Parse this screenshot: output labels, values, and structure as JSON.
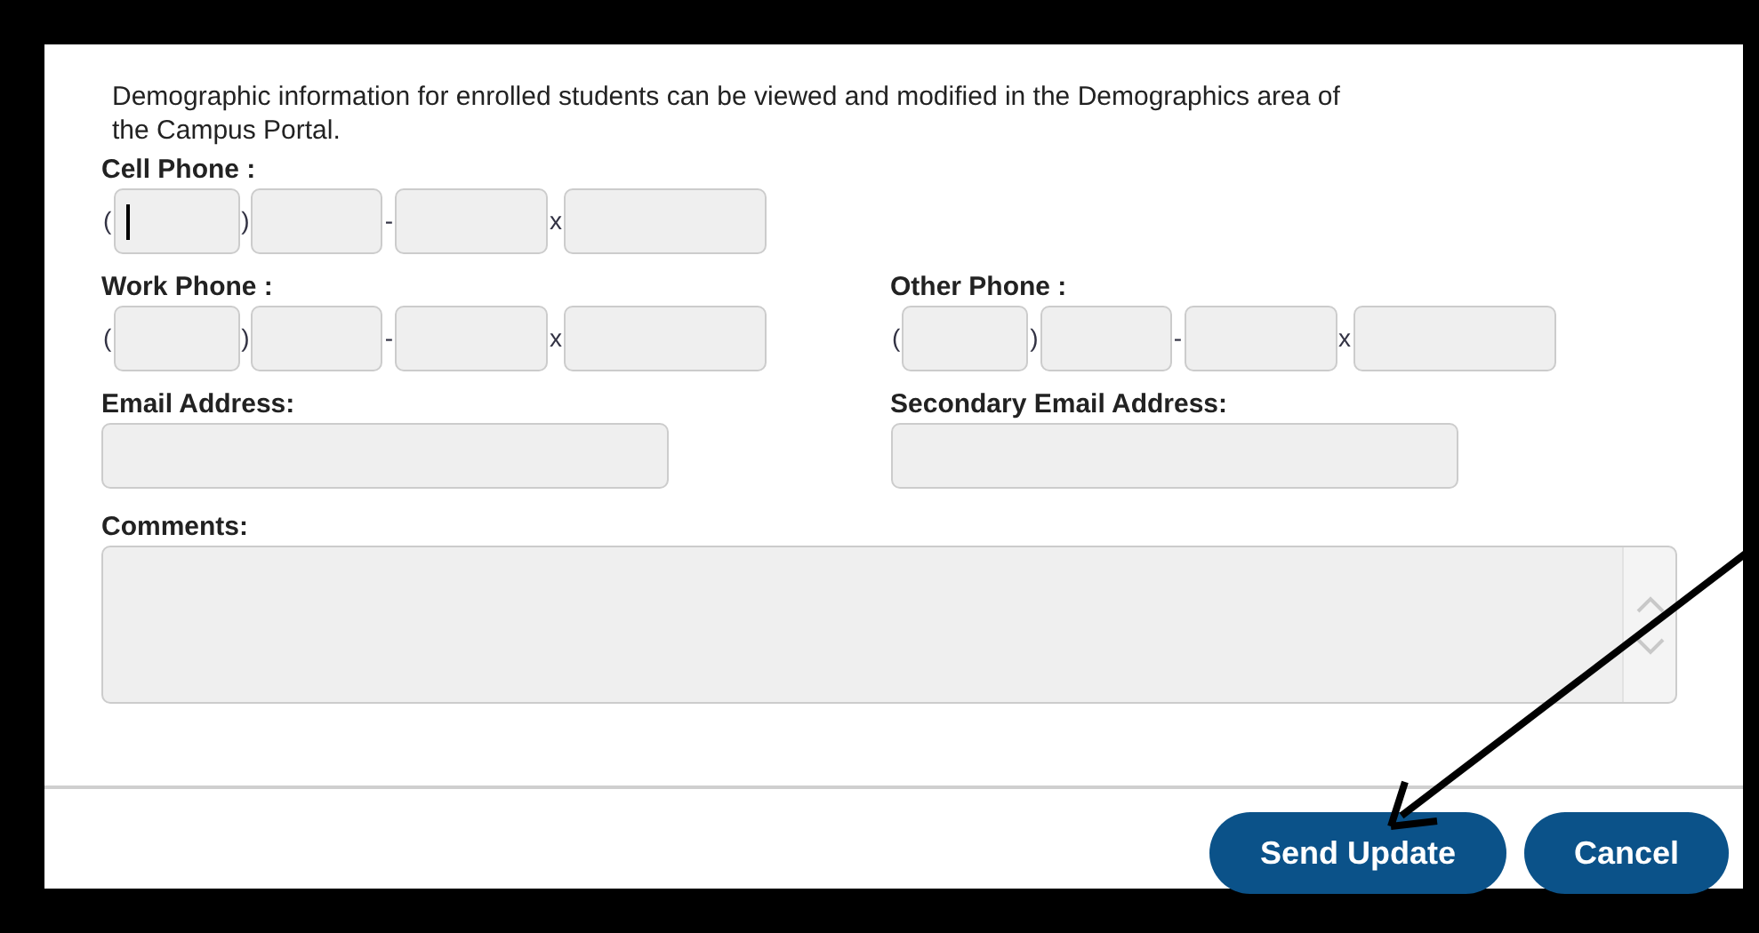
{
  "intro": "Demographic information for enrolled students can be viewed and modified in the Demographics area of the Campus Portal.",
  "phone_rows": [
    [
      {
        "label": "Cell Phone :",
        "separators": [
          "(",
          ")",
          "-",
          "x"
        ],
        "focused": true
      }
    ],
    [
      {
        "label": "Work Phone :",
        "separators": [
          "(",
          ")",
          "-",
          "x"
        ],
        "focused": false
      },
      {
        "label": "Other Phone :",
        "separators": [
          "(",
          ")",
          "-",
          "x"
        ],
        "focused": false
      }
    ]
  ],
  "emails": [
    {
      "label": "Email Address:"
    },
    {
      "label": "Secondary Email Address:"
    }
  ],
  "comments": {
    "label": "Comments:"
  },
  "buttons": [
    {
      "label": "Send Update"
    },
    {
      "label": "Cancel"
    }
  ]
}
